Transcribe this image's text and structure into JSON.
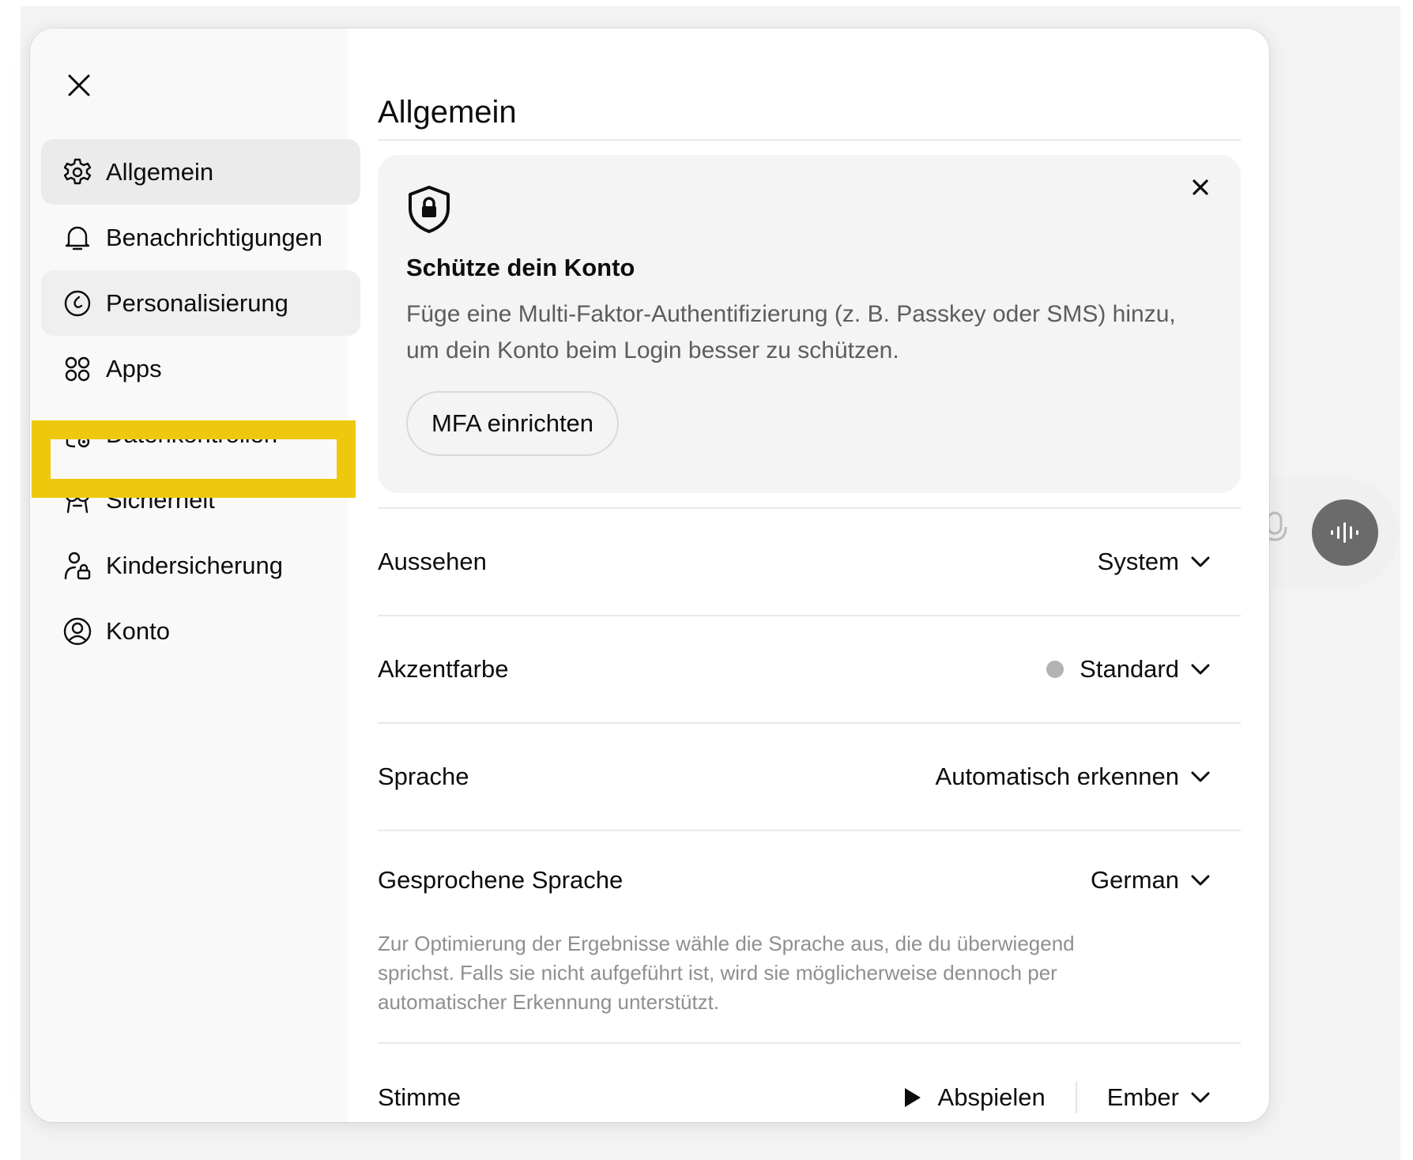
{
  "sidebar": {
    "items": [
      {
        "label": "Allgemein",
        "icon": "gear-icon"
      },
      {
        "label": "Benachrichtigungen",
        "icon": "bell-icon"
      },
      {
        "label": "Personalisierung",
        "icon": "personalization-icon"
      },
      {
        "label": "Apps",
        "icon": "apps-grid-icon"
      },
      {
        "label": "Datenkontrollen",
        "icon": "database-settings-icon"
      },
      {
        "label": "Sicherheit",
        "icon": "shield-key-icon"
      },
      {
        "label": "Kindersicherung",
        "icon": "parental-lock-icon"
      },
      {
        "label": "Konto",
        "icon": "account-icon"
      }
    ]
  },
  "main": {
    "title": "Allgemein",
    "mfa": {
      "title": "Schütze dein Konto",
      "text": "Füge eine Multi-Faktor-Authentifizierung (z. B. Passkey oder SMS) hinzu, um dein Konto beim Login besser zu schützen.",
      "button": "MFA einrichten"
    },
    "settings": {
      "appearance": {
        "label": "Aussehen",
        "value": "System"
      },
      "accent": {
        "label": "Akzentfarbe",
        "value": "Standard",
        "color": "#b3b3b3"
      },
      "language": {
        "label": "Sprache",
        "value": "Automatisch erkennen"
      },
      "spoken": {
        "label": "Gesprochene Sprache",
        "value": "German",
        "hint": "Zur Optimierung der Ergebnisse wähle die Sprache aus, die du überwiegend sprichst. Falls sie nicht aufgeführt ist, wird sie möglicherweise dennoch per automatischer Erkennung unterstützt."
      },
      "voice": {
        "label": "Stimme",
        "play": "Abspielen",
        "value": "Ember"
      }
    }
  },
  "colors": {
    "highlight": "#eec80d",
    "active_nav": "#ebebeb"
  }
}
